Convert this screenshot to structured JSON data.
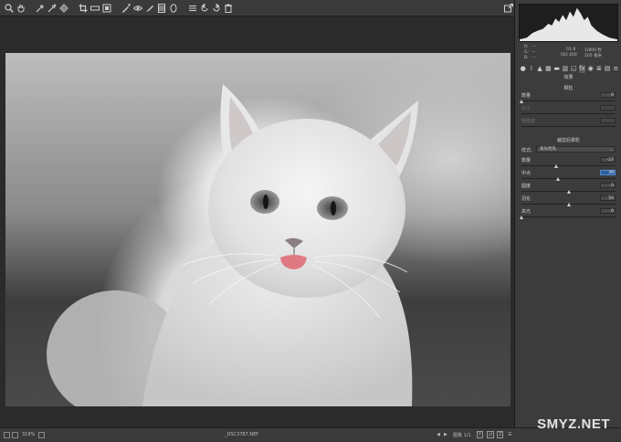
{
  "toolbar": {
    "tools": [
      {
        "name": "zoom-icon",
        "glyph": "🔍"
      },
      {
        "name": "hand-icon",
        "glyph": "✋"
      },
      {
        "name": "white-balance-icon",
        "glyph": "✎"
      },
      {
        "name": "color-sampler-icon",
        "glyph": "✎"
      },
      {
        "name": "targeted-adjustment-icon",
        "glyph": "⌖"
      },
      {
        "name": "crop-icon",
        "glyph": "⌗"
      },
      {
        "name": "straighten-icon",
        "glyph": "▭"
      },
      {
        "name": "transform-icon",
        "glyph": "⊡"
      },
      {
        "name": "spot-removal-icon",
        "glyph": "✐"
      },
      {
        "name": "red-eye-icon",
        "glyph": "⊙"
      },
      {
        "name": "adjustment-brush-icon",
        "glyph": "✏"
      },
      {
        "name": "graduated-filter-icon",
        "glyph": "▤"
      },
      {
        "name": "radial-filter-icon",
        "glyph": "◯"
      },
      {
        "name": "preferences-icon",
        "glyph": "☰"
      },
      {
        "name": "rotate-left-icon",
        "glyph": "↺"
      },
      {
        "name": "rotate-right-icon",
        "glyph": "↻"
      },
      {
        "name": "trash-icon",
        "glyph": "🗑"
      }
    ]
  },
  "status": {
    "zoom": "319%",
    "filename": "_DSC3787.NEF",
    "image_counter": "图像 1/1",
    "btn_y": "Y",
    "btn_z": "Z"
  },
  "camera_info": {
    "r_label": "R:",
    "g_label": "G:",
    "b_label": "B:",
    "r_value": "---",
    "g_value": "---",
    "b_value": "---",
    "aperture": "f/1.8",
    "shutter": "1/800 秒",
    "iso": "ISO 400",
    "focal": "105 毫米"
  },
  "panel": {
    "section_title": "效果",
    "grain_title": "颗粒",
    "grain_rows": [
      {
        "label": "数量",
        "value": "0",
        "thumb": 0.0,
        "disabled": false
      },
      {
        "label": "大小",
        "value": "",
        "thumb": 0.0,
        "disabled": true
      },
      {
        "label": "粗糙度",
        "value": "",
        "thumb": 0.0,
        "disabled": true
      }
    ],
    "vignette_title": "裁剪后晕影",
    "style_label": "样式:",
    "style_value": "高光优先",
    "vignette_rows": [
      {
        "label": "数量",
        "value": "-27",
        "thumb": 0.365,
        "focus": false
      },
      {
        "label": "中点",
        "value": "39",
        "thumb": 0.39,
        "focus": true
      },
      {
        "label": "圆度",
        "value": "0",
        "thumb": 0.5,
        "focus": false
      },
      {
        "label": "羽化",
        "value": "50",
        "thumb": 0.5,
        "focus": false
      },
      {
        "label": "高光",
        "value": "0",
        "thumb": 0.0,
        "focus": false
      }
    ]
  },
  "watermark": "SMYZ.NET",
  "colors": {
    "panel_bg": "#3c3c3c",
    "canvas_bg": "#2b2b2b",
    "focus_blue": "#2e5f96",
    "tongue_pink": "#e07a82"
  }
}
